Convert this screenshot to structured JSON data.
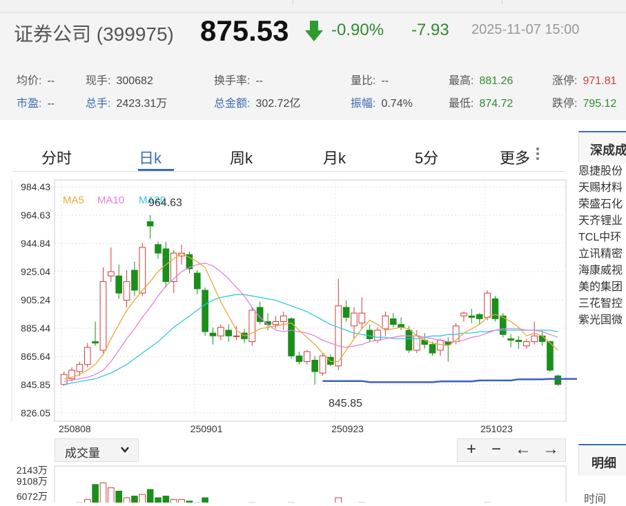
{
  "header": {
    "stock_name": "证券公司 (399975)",
    "price": "875.53",
    "change_pct": "-0.90%",
    "change": "-7.93",
    "timestamp": "2025-11-07 15:00"
  },
  "stats_row1": [
    {
      "label": "均价:",
      "value": "--"
    },
    {
      "label": "现手:",
      "value": "300682"
    },
    {
      "label": "换手率:",
      "value": "--"
    },
    {
      "label": "量比:",
      "value": "--"
    },
    {
      "label": "最高:",
      "value": "881.26"
    },
    {
      "label": "涨停:",
      "value": "971.81"
    }
  ],
  "stats_row2": [
    {
      "label": "市盈:",
      "value": "--"
    },
    {
      "label": "总手:",
      "value": "2423.31万"
    },
    {
      "label": "总金额:",
      "value": "302.72亿"
    },
    {
      "label": "振幅:",
      "value": "0.74%"
    },
    {
      "label": "最低:",
      "value": "874.72"
    },
    {
      "label": "跌停:",
      "value": "795.12"
    }
  ],
  "tabs": [
    "分时",
    "日k",
    "周k",
    "月k",
    "5分",
    "更多"
  ],
  "active_tab": "日k",
  "chart_data": {
    "type": "candlestick",
    "y_ticks": [
      "984.43",
      "964.63",
      "944.84",
      "925.04",
      "905.24",
      "885.44",
      "865.64",
      "845.85",
      "826.05"
    ],
    "ylim": [
      826.05,
      984.43
    ],
    "x_labels": [
      "250808",
      "250901",
      "250923",
      "251023"
    ],
    "legend": [
      {
        "name": "MA5",
        "color": "#e8a838"
      },
      {
        "name": "MA10",
        "color": "#e080e0"
      },
      {
        "name": "MA20",
        "color": "#30c8e0"
      }
    ],
    "annotations": {
      "high": "964.63",
      "low": "845.85"
    },
    "candles": [
      {
        "o": 846,
        "c": 853,
        "h": 855,
        "l": 845
      },
      {
        "o": 850,
        "c": 856,
        "h": 858,
        "l": 848
      },
      {
        "o": 855,
        "c": 860,
        "h": 862,
        "l": 852
      },
      {
        "o": 860,
        "c": 872,
        "h": 875,
        "l": 858
      },
      {
        "o": 876,
        "c": 875,
        "h": 890,
        "l": 873
      },
      {
        "o": 870,
        "c": 918,
        "h": 928,
        "l": 868
      },
      {
        "o": 922,
        "c": 925,
        "h": 942,
        "l": 918
      },
      {
        "o": 922,
        "c": 910,
        "h": 930,
        "l": 906
      },
      {
        "o": 905,
        "c": 918,
        "h": 926,
        "l": 900
      },
      {
        "o": 926,
        "c": 912,
        "h": 932,
        "l": 908
      },
      {
        "o": 910,
        "c": 942,
        "h": 945,
        "l": 908
      },
      {
        "o": 960,
        "c": 957,
        "h": 964.6,
        "l": 948
      },
      {
        "o": 944,
        "c": 938,
        "h": 946,
        "l": 934
      },
      {
        "o": 941,
        "c": 918,
        "h": 946,
        "l": 914
      },
      {
        "o": 918,
        "c": 938,
        "h": 940,
        "l": 910
      },
      {
        "o": 936,
        "c": 938,
        "h": 944,
        "l": 930
      },
      {
        "o": 937,
        "c": 927,
        "h": 939,
        "l": 924
      },
      {
        "o": 924,
        "c": 913,
        "h": 926,
        "l": 909
      },
      {
        "o": 912,
        "c": 883,
        "h": 914,
        "l": 880
      },
      {
        "o": 882,
        "c": 880,
        "h": 886,
        "l": 874
      },
      {
        "o": 880,
        "c": 886,
        "h": 888,
        "l": 877
      },
      {
        "o": 884,
        "c": 880,
        "h": 888,
        "l": 876
      },
      {
        "o": 880,
        "c": 880,
        "h": 887,
        "l": 877
      },
      {
        "o": 882,
        "c": 878,
        "h": 885,
        "l": 875
      },
      {
        "o": 876,
        "c": 898,
        "h": 900,
        "l": 873
      },
      {
        "o": 900,
        "c": 890,
        "h": 904,
        "l": 888
      },
      {
        "o": 890,
        "c": 888,
        "h": 896,
        "l": 884
      },
      {
        "o": 888,
        "c": 890,
        "h": 894,
        "l": 885
      },
      {
        "o": 890,
        "c": 894,
        "h": 897,
        "l": 884
      },
      {
        "o": 892,
        "c": 866,
        "h": 893,
        "l": 864
      },
      {
        "o": 866,
        "c": 862,
        "h": 869,
        "l": 860
      },
      {
        "o": 862,
        "c": 869,
        "h": 870,
        "l": 860
      },
      {
        "o": 863,
        "c": 855,
        "h": 866,
        "l": 846
      },
      {
        "o": 854,
        "c": 866,
        "h": 868,
        "l": 852
      },
      {
        "o": 865,
        "c": 860,
        "h": 867,
        "l": 859
      },
      {
        "o": 859,
        "c": 901,
        "h": 920,
        "l": 856
      },
      {
        "o": 900,
        "c": 893,
        "h": 905,
        "l": 890
      },
      {
        "o": 887,
        "c": 896,
        "h": 900,
        "l": 878
      },
      {
        "o": 889,
        "c": 896,
        "h": 907,
        "l": 885
      },
      {
        "o": 884,
        "c": 878,
        "h": 888,
        "l": 876
      },
      {
        "o": 877,
        "c": 884,
        "h": 886,
        "l": 875
      },
      {
        "o": 885,
        "c": 894,
        "h": 897,
        "l": 880
      },
      {
        "o": 892,
        "c": 888,
        "h": 896,
        "l": 886
      },
      {
        "o": 888,
        "c": 886,
        "h": 893,
        "l": 884
      },
      {
        "o": 884,
        "c": 870,
        "h": 887,
        "l": 868
      },
      {
        "o": 870,
        "c": 880,
        "h": 884,
        "l": 868
      },
      {
        "o": 877,
        "c": 874,
        "h": 882,
        "l": 871
      },
      {
        "o": 874,
        "c": 868,
        "h": 876,
        "l": 866
      },
      {
        "o": 870,
        "c": 877,
        "h": 878,
        "l": 866
      },
      {
        "o": 876,
        "c": 874,
        "h": 879,
        "l": 862
      },
      {
        "o": 876,
        "c": 887,
        "h": 889,
        "l": 874
      },
      {
        "o": 894,
        "c": 896,
        "h": 897,
        "l": 890
      },
      {
        "o": 894,
        "c": 893,
        "h": 899,
        "l": 889
      },
      {
        "o": 895,
        "c": 892,
        "h": 896,
        "l": 888
      },
      {
        "o": 893,
        "c": 910,
        "h": 912,
        "l": 891
      },
      {
        "o": 906,
        "c": 892,
        "h": 908,
        "l": 890
      },
      {
        "o": 894,
        "c": 881,
        "h": 896,
        "l": 879
      },
      {
        "o": 878,
        "c": 877,
        "h": 881,
        "l": 872
      },
      {
        "o": 877,
        "c": 876,
        "h": 880,
        "l": 871
      },
      {
        "o": 873,
        "c": 876,
        "h": 878,
        "l": 871
      },
      {
        "o": 876,
        "c": 880,
        "h": 890,
        "l": 874
      },
      {
        "o": 880,
        "c": 876,
        "h": 884,
        "l": 873
      },
      {
        "o": 876,
        "c": 856,
        "h": 877,
        "l": 855
      },
      {
        "o": 852,
        "c": 846,
        "h": 853,
        "l": 845
      }
    ],
    "ma5": [
      850,
      851,
      853,
      856,
      860,
      867,
      878,
      888,
      898,
      905,
      912,
      918,
      925,
      930,
      934,
      938,
      935,
      932,
      928,
      916,
      904,
      894,
      884,
      880,
      882,
      885,
      886,
      887,
      888,
      889,
      884,
      879,
      874,
      868,
      862,
      862,
      870,
      878,
      885,
      891,
      888,
      884,
      885,
      886,
      885,
      880,
      877,
      875,
      874,
      873,
      877,
      882,
      885,
      888,
      893,
      895,
      893,
      890,
      886,
      880,
      882,
      880,
      875,
      870
    ],
    "ma10": [
      848,
      849,
      850,
      851,
      853,
      856,
      862,
      870,
      878,
      885,
      893,
      900,
      908,
      915,
      920,
      925,
      928,
      930,
      931,
      929,
      925,
      920,
      914,
      908,
      900,
      893,
      888,
      884,
      883,
      884,
      883,
      882,
      880,
      877,
      875,
      873,
      872,
      873,
      874,
      876,
      877,
      878,
      879,
      880,
      880,
      880,
      879,
      878,
      877,
      876,
      876,
      877,
      879,
      880,
      882,
      884,
      885,
      885,
      885,
      884,
      884,
      883,
      881,
      879
    ],
    "ma20": [
      846,
      847,
      848,
      849,
      850,
      852,
      854,
      857,
      860,
      864,
      868,
      872,
      876,
      881,
      886,
      890,
      894,
      898,
      902,
      905,
      907,
      908,
      909,
      909,
      908,
      907,
      906,
      905,
      903,
      901,
      899,
      897,
      894,
      891,
      888,
      886,
      884,
      882,
      881,
      880,
      879,
      879,
      878,
      878,
      878,
      878,
      879,
      880,
      880,
      881,
      881,
      882,
      882,
      883,
      883,
      884,
      884,
      884,
      884,
      884,
      884,
      884,
      884,
      883
    ],
    "volume_labels": [
      "2143万",
      "9108万",
      "6072万"
    ],
    "volume_selector": "成交量",
    "volume_bars": [
      0.2,
      0.25,
      0.35,
      0.45,
      0.9,
      0.95,
      0.8,
      0.7,
      0.5,
      0.55,
      0.6,
      0.75,
      0.5,
      0.55,
      0.45,
      0.45,
      0.4,
      0.35,
      0.5,
      0.3,
      0.25,
      0.2,
      0.2,
      0.2,
      0.35,
      0.3,
      0.25,
      0.2,
      0.2,
      0.35,
      0.2,
      0.2,
      0.3,
      0.25,
      0.2,
      0.5,
      0.3,
      0.3,
      0.35,
      0.25,
      0.2,
      0.25,
      0.2,
      0.2,
      0.25,
      0.2,
      0.2,
      0.2,
      0.2,
      0.2,
      0.25,
      0.3,
      0.25,
      0.25,
      0.35,
      0.3,
      0.25,
      0.2,
      0.2,
      0.2,
      0.2,
      0.2,
      0.25,
      0.2
    ]
  },
  "zoom_controls": [
    "+",
    "−",
    "←",
    "→"
  ],
  "sidebar": {
    "title": "深成成",
    "items": [
      "恩捷股份",
      "天赐材料",
      "荣盛石化",
      "天齐锂业",
      "TCL中环",
      "立讯精密",
      "海康威视",
      "美的集团",
      "三花智控",
      "紫光国微"
    ],
    "detail_title": "明细",
    "time_label": "时间"
  },
  "colors": {
    "up": "#d03a3a",
    "down": "#1a8f1a",
    "link": "#3a6db0",
    "price_line": "#3a5fc8"
  }
}
